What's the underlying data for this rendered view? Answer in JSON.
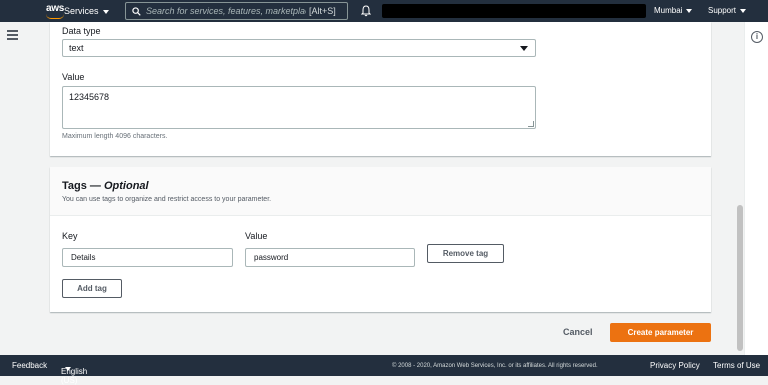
{
  "topnav": {
    "logo_text": "aws",
    "services_label": "Services",
    "search_placeholder": "Search for services, features, marketplace",
    "search_shortcut": "[Alt+S]",
    "region_label": "Mumbai",
    "support_label": "Support"
  },
  "form": {
    "data_type_label": "Data type",
    "data_type_value": "text",
    "value_label": "Value",
    "value_text": "12345678",
    "value_hint": "Maximum length 4096 characters."
  },
  "tags": {
    "title": "Tags —",
    "title_optional": "Optional",
    "description": "You can use tags to organize and restrict access to your parameter.",
    "key_label": "Key",
    "value_label": "Value",
    "key_value": "Details",
    "value_value": "password",
    "remove_tag_label": "Remove tag",
    "add_tag_label": "Add tag"
  },
  "actions": {
    "cancel_label": "Cancel",
    "create_label": "Create parameter"
  },
  "footer": {
    "feedback_label": "Feedback",
    "language_label": "English (US)",
    "copyright": "© 2008 - 2020, Amazon Web Services, Inc. or its affiliates. All rights reserved.",
    "privacy_label": "Privacy Policy",
    "terms_label": "Terms of Use"
  },
  "colors": {
    "nav_bg": "#232f3e",
    "primary_button": "#ec7211",
    "logo_accent": "#ff9900"
  },
  "icons": [
    "search-icon",
    "bell-icon",
    "menu-icon",
    "info-icon",
    "caret-down-icon"
  ]
}
